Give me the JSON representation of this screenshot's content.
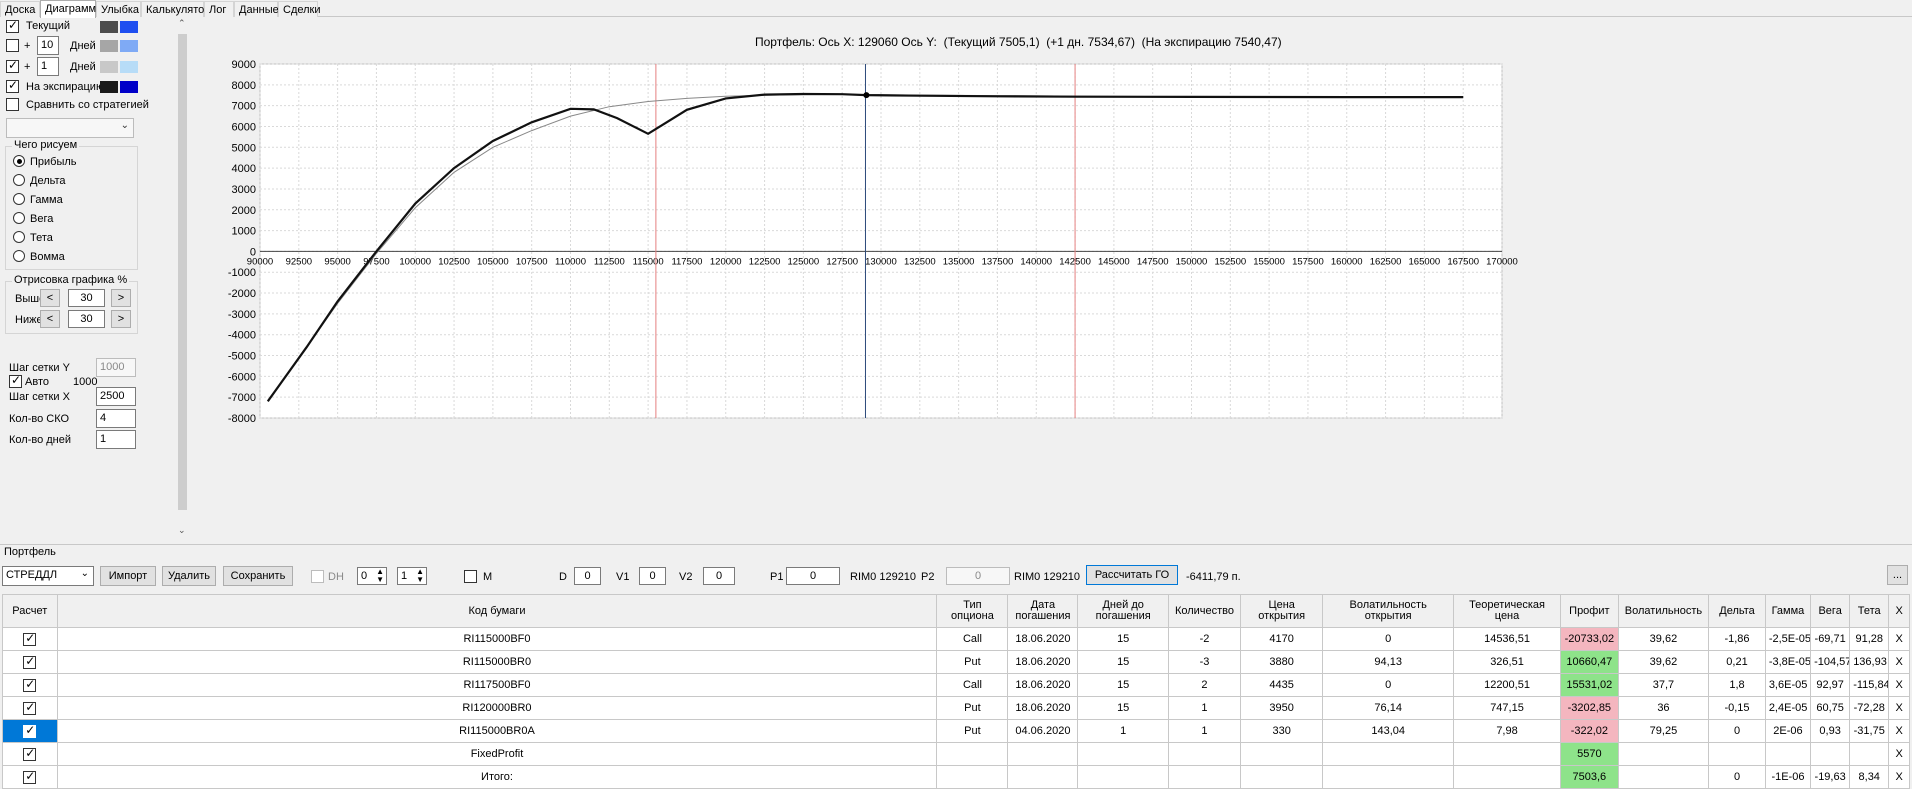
{
  "tabs": [
    "Доска",
    "Диаграмма",
    "Улыбка",
    "Калькулятор",
    "Лог",
    "Данные",
    "Сделки"
  ],
  "left_panel": {
    "current_label": "Текущий",
    "plus1": "+",
    "days1_value": "10",
    "days_label": "Дней",
    "plus2": "+",
    "days2_value": "1",
    "days_label2": "Дней",
    "expiration_label": "На экспирацию",
    "compare_label": "Сравнить со стратегией",
    "what_to_draw_title": "Чего рисуем",
    "radio_options": [
      "Прибыль",
      "Дельта",
      "Гамма",
      "Вега",
      "Тета",
      "Вомма"
    ],
    "draw_range_title": "Отрисовка графика %",
    "above_label": "Выше",
    "above_value": "30",
    "below_label": "Ниже",
    "below_value": "30",
    "grid_y_label": "Шаг сетки Y",
    "grid_y_value": "1000",
    "auto_label": "Авто",
    "auto_value": "1000",
    "grid_x_label": "Шаг сетки X",
    "grid_x_value": "2500",
    "sko_label": "Кол-во СКО",
    "sko_value": "4",
    "days_count_label": "Кол-во дней",
    "days_count_value": "1",
    "colors": {
      "sw1a": "#4d4d4d",
      "sw1b": "#1f4ff0",
      "sw2a": "#a6a6a6",
      "sw2b": "#7faaf5",
      "sw3a": "#c8c8c8",
      "sw3b": "#b7dcf7",
      "sw4a": "#1a1a1a",
      "sw4b": "#0000c8"
    }
  },
  "chart_header": {
    "portfolio": "Портфель:",
    "axis_x_label": "Ось X:",
    "axis_x_value": "129060",
    "axis_y_label": "Ось Y:",
    "current": "(Текущий 7505,1)",
    "plus_day": "(+1 дн. 7534,67)",
    "expiration": "(На экспирацию 7540,47)"
  },
  "chart_data": {
    "type": "line",
    "xlim": [
      90000,
      170000
    ],
    "ylim": [
      -8000,
      9000
    ],
    "x_ticks": [
      90000,
      92500,
      95000,
      97500,
      100000,
      102500,
      105000,
      107500,
      110000,
      112500,
      115000,
      117500,
      120000,
      122500,
      125000,
      127500,
      130000,
      132500,
      135000,
      137500,
      140000,
      142500,
      145000,
      147500,
      150000,
      152500,
      155000,
      157500,
      160000,
      162500,
      165000,
      167500,
      170000
    ],
    "y_ticks": [
      9000,
      8000,
      7000,
      6000,
      5000,
      4000,
      3000,
      2000,
      1000,
      0,
      -1000,
      -2000,
      -3000,
      -4000,
      -5000,
      -6000,
      -7000,
      -8000
    ],
    "grid": true,
    "series": [
      {
        "values": [
          [
            90500,
            -7200
          ],
          [
            93000,
            -4600
          ],
          [
            95000,
            -2500
          ],
          [
            97500,
            -100
          ],
          [
            100000,
            2100
          ],
          [
            102500,
            3800
          ],
          [
            105000,
            5000
          ],
          [
            107500,
            5800
          ],
          [
            110000,
            6500
          ],
          [
            112500,
            6950
          ],
          [
            115000,
            7200
          ],
          [
            117500,
            7350
          ],
          [
            120000,
            7450
          ],
          [
            122500,
            7500
          ],
          [
            125000,
            7530
          ],
          [
            127500,
            7540
          ],
          [
            130000,
            7520
          ],
          [
            135000,
            7490
          ],
          [
            140000,
            7470
          ],
          [
            145000,
            7450
          ],
          [
            150000,
            7440
          ],
          [
            160000,
            7420
          ],
          [
            167500,
            7410
          ]
        ],
        "color": "#888888",
        "width": 1
      },
      {
        "values": [
          [
            90500,
            -7200
          ],
          [
            93000,
            -4600
          ],
          [
            95000,
            -2400
          ],
          [
            97500,
            0
          ],
          [
            100000,
            2300
          ],
          [
            102500,
            4000
          ],
          [
            105000,
            5300
          ],
          [
            107500,
            6200
          ],
          [
            110000,
            6850
          ],
          [
            111500,
            6820
          ],
          [
            113000,
            6400
          ],
          [
            115000,
            5650
          ],
          [
            117500,
            6800
          ],
          [
            120000,
            7350
          ],
          [
            122500,
            7530
          ],
          [
            125000,
            7560
          ],
          [
            127500,
            7550
          ],
          [
            129060,
            7505
          ],
          [
            132500,
            7480
          ],
          [
            137500,
            7450
          ],
          [
            142500,
            7430
          ],
          [
            150000,
            7420
          ],
          [
            160000,
            7410
          ],
          [
            167500,
            7410
          ]
        ],
        "color": "#111111",
        "width": 2.2
      }
    ],
    "vlines": [
      {
        "x": 115500,
        "color": "#e58080"
      },
      {
        "x": 129000,
        "color": "#2c4a7a"
      },
      {
        "x": 142500,
        "color": "#e58080"
      }
    ],
    "point": [
      129060,
      7505
    ]
  },
  "portfolio": {
    "title": "Портфель",
    "strategy_value": "СТРЕДДЛ",
    "import_btn": "Импорт",
    "delete_btn": "Удалить",
    "save_btn": "Сохранить",
    "dh_label": "DH",
    "dh_value1": "0",
    "dh_value2": "1",
    "m_label": "M",
    "d_label": "D",
    "d_value": "0",
    "v1_label": "V1",
    "v1_value": "0",
    "v2_label": "V2",
    "v2_value": "0",
    "p1_label": "P1",
    "p1_value": "0",
    "rim1": "RIM0 129210",
    "p2_label": "P2",
    "p2_value": "0",
    "rim2": "RIM0 129210",
    "calc_btn": "Рассчитать ГО",
    "go_value": "-6411,79 п.",
    "more_btn": "..."
  },
  "table": {
    "headers": [
      "Расчет",
      "Код бумаги",
      "Тип опциона",
      "Дата погашения",
      "Дней до погашения",
      "Количество",
      "Цена открытия",
      "Волатильность открытия",
      "Теоретическая цена",
      "Профит",
      "Волатильность",
      "Дельта",
      "Гамма",
      "Вега",
      "Тета",
      "X"
    ],
    "rows": [
      [
        "RI115000BF0",
        "Call",
        "18.06.2020",
        "15",
        "-2",
        "4170",
        "0",
        "14536,51",
        "-20733,02",
        "39,62",
        "-1,86",
        "-2,5E-05",
        "-69,71",
        "91,28",
        "X"
      ],
      [
        "RI115000BR0",
        "Put",
        "18.06.2020",
        "15",
        "-3",
        "3880",
        "94,13",
        "326,51",
        "10660,47",
        "39,62",
        "0,21",
        "-3,8E-05",
        "-104,57",
        "136,93",
        "X"
      ],
      [
        "RI117500BF0",
        "Call",
        "18.06.2020",
        "15",
        "2",
        "4435",
        "0",
        "12200,51",
        "15531,02",
        "37,7",
        "1,8",
        "3,6E-05",
        "92,97",
        "-115,84",
        "X"
      ],
      [
        "RI120000BR0",
        "Put",
        "18.06.2020",
        "15",
        "1",
        "3950",
        "76,14",
        "747,15",
        "-3202,85",
        "36",
        "-0,15",
        "2,4E-05",
        "60,75",
        "-72,28",
        "X"
      ],
      [
        "RI115000BR0A",
        "Put",
        "04.06.2020",
        "1",
        "1",
        "330",
        "143,04",
        "7,98",
        "-322,02",
        "79,25",
        "0",
        "2E-06",
        "0,93",
        "-31,75",
        "X"
      ],
      [
        "FixedProfit",
        "",
        "",
        "",
        "",
        "",
        "",
        "",
        "5570",
        "",
        "",
        "",
        "",
        "",
        "X"
      ],
      [
        "Итого:",
        "",
        "",
        "",
        "",
        "",
        "",
        "",
        "7503,6",
        "",
        "0",
        "-1E-06",
        "-19,63",
        "8,34",
        "X"
      ]
    ],
    "profit_colors": [
      "red",
      "green",
      "green",
      "red",
      "red",
      "green",
      "green"
    ]
  }
}
